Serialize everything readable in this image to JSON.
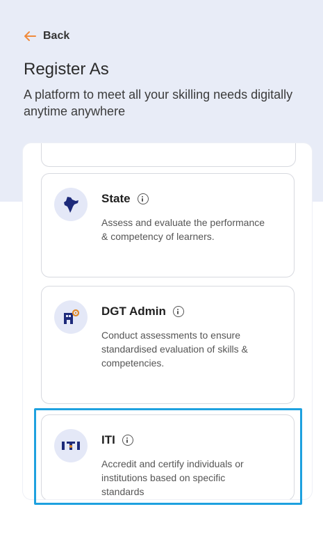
{
  "header": {
    "back_label": "Back",
    "title": "Register As",
    "subtitle": "A platform to meet all your skilling needs digitally anytime anywhere"
  },
  "colors": {
    "accent_orange": "#f08a3c",
    "icon_navy": "#1d2a7a",
    "selection_blue": "#1ea1df",
    "band_bg": "#e8ecf7"
  },
  "roles": [
    {
      "title": "State",
      "icon": "india-map-icon",
      "description": "Assess and evaluate the performance & competency of learners.",
      "selected": false
    },
    {
      "title": "DGT Admin",
      "icon": "admin-building-icon",
      "description": "Conduct assessments to ensure standardised evaluation of skills & competencies.",
      "selected": false
    },
    {
      "title": "ITI",
      "icon": "iti-logo-icon",
      "description": "Accredit and certify individuals or institutions based on specific standards",
      "selected": true
    }
  ]
}
